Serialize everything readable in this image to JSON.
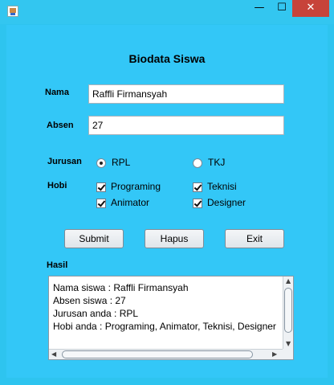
{
  "window": {
    "title": "",
    "minimize_glyph": "—",
    "maximize_glyph": "☐",
    "close_glyph": "✕"
  },
  "form": {
    "title": "Biodata Siswa",
    "nama_label": "Nama",
    "nama_value": "Raffli Firmansyah",
    "absen_label": "Absen",
    "absen_value": "27",
    "jurusan_label": "Jurusan",
    "jurusan_options": [
      {
        "label": "RPL",
        "selected": true
      },
      {
        "label": "TKJ",
        "selected": false
      }
    ],
    "hobi_label": "Hobi",
    "hobi_options": [
      {
        "label": "Programing",
        "checked": true
      },
      {
        "label": "Teknisi",
        "checked": true
      },
      {
        "label": "Animator",
        "checked": true
      },
      {
        "label": "Designer",
        "checked": true
      }
    ]
  },
  "buttons": {
    "submit": "Submit",
    "hapus": "Hapus",
    "exit": "Exit"
  },
  "hasil": {
    "label": "Hasil",
    "lines": [
      "Nama siswa : Raffli Firmansyah",
      "Absen siswa : 27",
      "Jurusan anda : RPL",
      "Hobi anda : Programing, Animator, Teknisi, Designer"
    ]
  },
  "colors": {
    "background": "#33c7f7",
    "close_button": "#c7433a"
  },
  "icons": [
    "app-icon",
    "minimize-icon",
    "maximize-icon",
    "close-icon",
    "scroll-up-icon",
    "scroll-down-icon",
    "scroll-left-icon",
    "scroll-right-icon"
  ]
}
